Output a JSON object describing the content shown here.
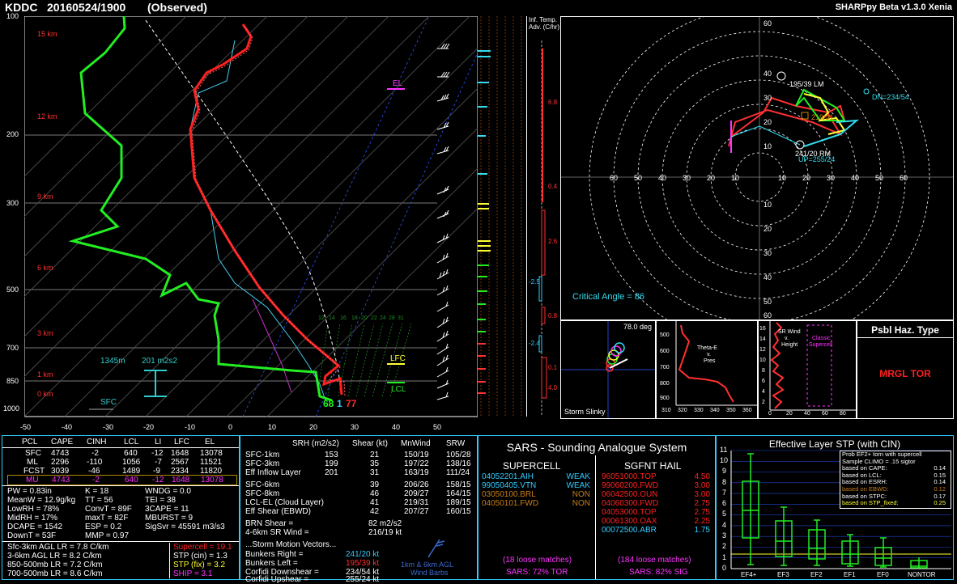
{
  "header": {
    "station": "KDDC",
    "datetime": "20160524/1900",
    "status": "(Observed)",
    "version": "SHARPpy Beta v1.3.0 Xenia"
  },
  "skewt": {
    "pressure_ticks": [
      "100",
      "200",
      "300",
      "500",
      "700",
      "850",
      "1000"
    ],
    "temp_ticks": [
      "-50",
      "-40",
      "-30",
      "-20",
      "-10",
      "0",
      "10",
      "20",
      "30",
      "40",
      "50"
    ],
    "height_labels": [
      "15 km",
      "12 km",
      "9 km",
      "6 km",
      "3 km",
      "1 km",
      "0 km"
    ],
    "el_label": "EL",
    "lfc_label": "LFC",
    "lcl_label": "LCL",
    "sfc_label": "SFC",
    "eff_inflow_depth": "1345m",
    "eff_inflow_srh": "201 m2s2",
    "sfc_temp": "77",
    "sfc_dewp": "68",
    "wetbulb_label": "1",
    "mix_ticks": [
      "12",
      "14",
      "16",
      "18",
      "20",
      "22",
      "24",
      "28",
      "31"
    ]
  },
  "temp_adv": {
    "title1": "Inf. Temp.",
    "title2": "Adv. (C/hr)",
    "values": [
      "6.8",
      "0.4",
      "2.6",
      "-2.5",
      "0.8",
      "-2.4",
      "0.1",
      "4.0"
    ]
  },
  "hodograph": {
    "rings": [
      "10",
      "20",
      "30",
      "40",
      "50",
      "60"
    ],
    "lm": "195/39 LM",
    "rm": "241/20 RM",
    "dn": "DN=234/54",
    "up": "UP=255/24",
    "mean": "219/31",
    "critical_angle": "Critical Angle = 86"
  },
  "slinky": {
    "angle": "78.0 deg",
    "label": "Storm Slinky"
  },
  "thetae": {
    "title1": "Theta-E",
    "title2": "v.",
    "title3": "Pres",
    "y_ticks": [
      "500",
      "600",
      "700",
      "800",
      "900"
    ],
    "x_ticks": [
      "310",
      "320",
      "330",
      "340",
      "350",
      "360"
    ]
  },
  "srwind": {
    "title1": "SR Wind",
    "title2": "v.",
    "title3": "Height",
    "classic1": "Classic",
    "classic2": "Supercell",
    "y_ticks": [
      "16",
      "14",
      "12",
      "10",
      "8",
      "6",
      "4",
      "2",
      "0"
    ],
    "x_ticks": [
      "0",
      "20",
      "40",
      "60",
      "80"
    ]
  },
  "hazard": {
    "title": "Psbl Haz. Type",
    "value": "MRGL TOR"
  },
  "parcels": {
    "headers": [
      "PCL",
      "CAPE",
      "CINH",
      "LCL",
      "LI",
      "LFC",
      "EL"
    ],
    "rows": [
      [
        "SFC",
        "4743",
        "-2",
        "640",
        "-12",
        "1648",
        "13078"
      ],
      [
        "ML",
        "2296",
        "-110",
        "2567",
        "-7",
        "11521",
        ""
      ],
      [
        "FCST",
        "3039",
        "-46",
        "1489",
        "-9",
        "2334",
        "11820"
      ],
      [
        "MU",
        "4743",
        "-2",
        "640",
        "-12",
        "1648",
        "13078"
      ]
    ],
    "ml_lcl": "1056"
  },
  "indices": {
    "col1": [
      "PW = 0.83in",
      "MeanW = 12.9g/kg",
      "LowRH = 78%",
      "MidRH = 17%",
      "DCAPE = 1542",
      "DownT = 53F"
    ],
    "col2": [
      "K = 18",
      "TT = 56",
      "ConvT = 89F",
      "maxT = 82F",
      "ESP = 0.2",
      "MMP = 0.97"
    ],
    "col3": [
      "WNDG = 0.0",
      "TEI = 38",
      "3CAPE = 11",
      "MBURST = 9",
      "",
      "SigSvr = 45591 m3/s3"
    ],
    "lapse": [
      "Sfc-3km AGL LR = 7.8 C/km",
      "3-6km AGL LR = 8.2 C/km",
      "850-500mb LR = 7.2 C/km",
      "700-500mb LR = 8.6 C/km"
    ],
    "comp": [
      "Supercell = 19.1",
      "STP (cin) = 1.3",
      "STP (fix) = 3.2",
      "SHIP = 3.1"
    ]
  },
  "kinematics": {
    "headers": [
      "SRH (m2/s2)",
      "Shear (kt)",
      "MnWind",
      "SRW"
    ],
    "rows": [
      [
        "SFC-1km",
        "153",
        "21",
        "150/19",
        "105/28"
      ],
      [
        "SFC-3km",
        "199",
        "35",
        "197/22",
        "138/16"
      ],
      [
        "Eff Inflow Layer",
        "201",
        "31",
        "163/19",
        "111/24"
      ],
      [
        "",
        "",
        "",
        "",
        ""
      ],
      [
        "SFC-6km",
        "",
        "39",
        "206/26",
        "158/15"
      ],
      [
        "SFC-8km",
        "",
        "46",
        "209/27",
        "164/15"
      ],
      [
        "LCL-EL (Cloud Layer)",
        "",
        "41",
        "219/31",
        "189/15"
      ],
      [
        "Eff Shear (EBWD)",
        "",
        "42",
        "207/27",
        "160/15"
      ]
    ],
    "brn": [
      "BRN Shear =",
      "82 m2/s2"
    ],
    "srw46": [
      "4-6km SR Wind =",
      "216/19 kt"
    ],
    "motion_title": "...Storm Motion Vectors...",
    "motion": [
      [
        "Bunkers Right =",
        "241/20 kt"
      ],
      [
        "Bunkers Left =",
        "195/39 kt"
      ],
      [
        "Corfidi Downshear =",
        "234/54 kt"
      ],
      [
        "Corfidi Upshear =",
        "255/24 kt"
      ]
    ],
    "barbs_label1": "1km & 6km AGL",
    "barbs_label2": "Wind Barbs"
  },
  "sars": {
    "title": "SARS - Sounding Analogue System",
    "supercell_title": "SUPERCELL",
    "hail_title": "SGFNT HAIL",
    "supercell": [
      [
        "04052201.AIH",
        "WEAK"
      ],
      [
        "99050405.VTN",
        "WEAK"
      ],
      [
        "03050100.BRL",
        "NON"
      ],
      [
        "04050101.FWD",
        "NON"
      ]
    ],
    "hail": [
      [
        "96051000.TOP",
        "4.50"
      ],
      [
        "99060200.FWD",
        "3.00"
      ],
      [
        "06042500.OUN",
        "3.00"
      ],
      [
        "04060300.FWD",
        "2.75"
      ],
      [
        "04053000.TOP",
        "2.75"
      ],
      [
        "00061300.OAX",
        "2.25"
      ],
      [
        "00072500.ABR",
        "1.75"
      ]
    ],
    "supercell_matches": "(18 loose matches)",
    "hail_matches": "(184 loose matches)",
    "supercell_result": "SARS: 72% TOR",
    "hail_result": "SARS: 82% SIG"
  },
  "stp": {
    "title": "Effective Layer STP (with CIN)",
    "y_ticks": [
      "11",
      "10",
      "9",
      "8",
      "7",
      "6",
      "5",
      "4",
      "3",
      "2",
      "1",
      "0"
    ],
    "categories": [
      "EF4+",
      "EF3",
      "EF2",
      "EF1",
      "EF0",
      "NONTOR"
    ],
    "legend_title1": "Prob EF2+ torn with supercell",
    "legend_title2": "Sample CLIMO = .15 sigtor",
    "legend": [
      [
        "based on CAPE:",
        "0.14"
      ],
      [
        "based on LCL:",
        "0.15"
      ],
      [
        "based on ESRH:",
        "0.14"
      ],
      [
        "based on EBWD:",
        "0.12"
      ],
      [
        "based on STPC:",
        "0.17"
      ],
      [
        "based on STP_fixed:",
        "0.25"
      ]
    ]
  },
  "colors": {
    "temp": "#ff2020",
    "dewp": "#20ff20",
    "virtual": "#ff4040",
    "wetbulb": "#20c0ff",
    "parcel": "#ffffff",
    "frame": "#ffffff",
    "panel_border": "#33ccff",
    "yellow": "#ffff33",
    "magenta": "#ff33ff",
    "cyan": "#33ddee"
  }
}
